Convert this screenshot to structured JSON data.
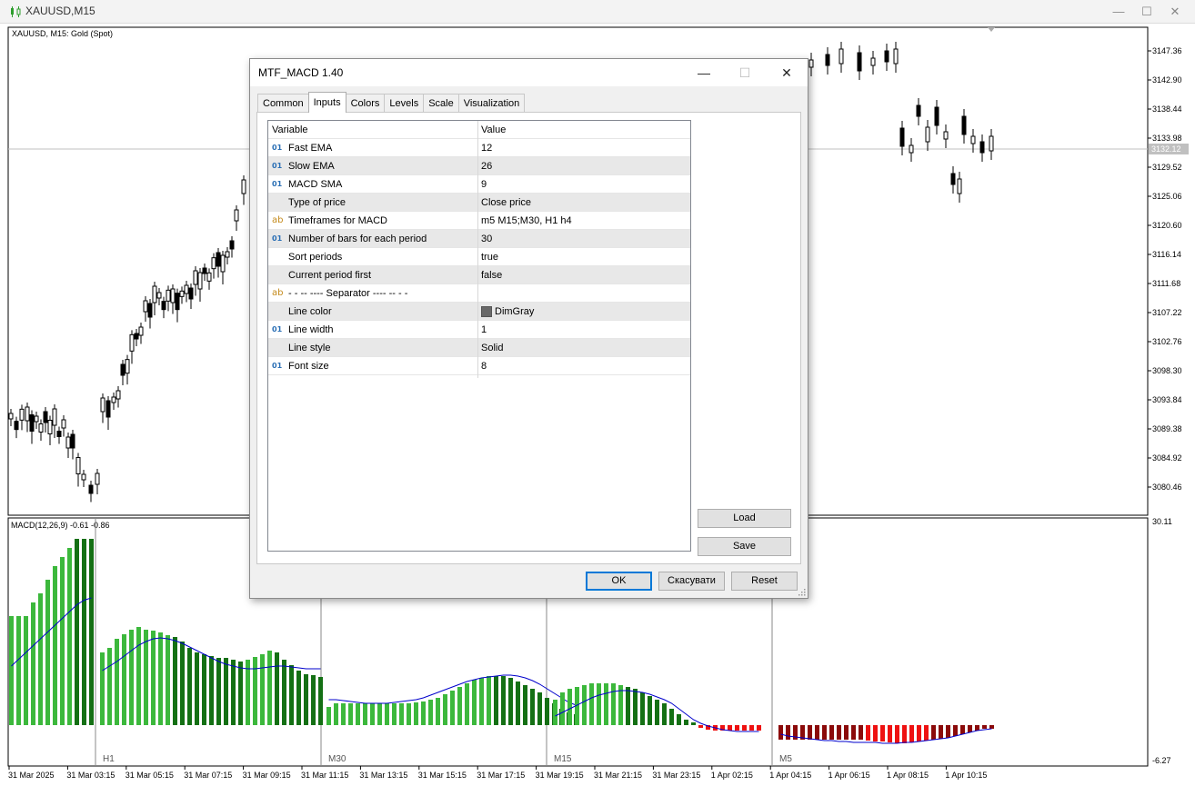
{
  "window": {
    "title": "XAUUSD,M15"
  },
  "chart": {
    "symbol_label": "XAUUSD, M15:  Gold (Spot)",
    "price_labels": [
      "3147.36",
      "3142.90",
      "3138.44",
      "3133.98",
      "3129.52",
      "3125.06",
      "3120.60",
      "3116.14",
      "3111.68",
      "3107.22",
      "3102.76",
      "3098.30",
      "3093.84",
      "3089.38",
      "3084.92",
      "3080.46"
    ],
    "current_price": "3132.12",
    "indicator_label": "MACD(12,26,9) -0.61 -0.86",
    "indicator_scale": [
      "30.11",
      "-6.27"
    ],
    "section_labels": [
      "H1",
      "M30",
      "M15",
      "M5"
    ],
    "time_labels": [
      "31 Mar 2025",
      "31 Mar 03:15",
      "31 Mar 05:15",
      "31 Mar 07:15",
      "31 Mar 09:15",
      "31 Mar 11:15",
      "31 Mar 13:15",
      "31 Mar 15:15",
      "31 Mar 17:15",
      "31 Mar 19:15",
      "31 Mar 21:15",
      "31 Mar 23:15",
      "1 Apr 02:15",
      "1 Apr 04:15",
      "1 Apr 06:15",
      "1 Apr 08:15",
      "1 Apr 10:15"
    ],
    "colors": {
      "bull_bar": "#3cb83c",
      "bear_bar": "#147014",
      "neg_bar": "#ee1111",
      "neg_dark_bar": "#8b0a0a",
      "signal_line": "#0000cc",
      "current_price_line": "#c0c0c0"
    }
  },
  "dialog": {
    "title": "MTF_MACD 1.40",
    "tabs": [
      {
        "label": "Common",
        "active": false
      },
      {
        "label": "Inputs",
        "active": true
      },
      {
        "label": "Colors",
        "active": false
      },
      {
        "label": "Levels",
        "active": false
      },
      {
        "label": "Scale",
        "active": false
      },
      {
        "label": "Visualization",
        "active": false
      }
    ],
    "grid_header": {
      "variable": "Variable",
      "value": "Value"
    },
    "rows": [
      {
        "icon": "int-icon",
        "icon_text": "01",
        "variable": "Fast EMA",
        "value": "12"
      },
      {
        "icon": "int-icon",
        "icon_text": "01",
        "variable": "Slow EMA",
        "value": "26"
      },
      {
        "icon": "int-icon",
        "icon_text": "01",
        "variable": "MACD SMA",
        "value": "9"
      },
      {
        "icon": "enum-icon",
        "icon_text": "",
        "variable": "Type of price",
        "value": "Close price"
      },
      {
        "icon": "string-icon",
        "icon_text": "ab",
        "variable": "Timeframes for MACD",
        "value": "m5 M15;M30, H1 h4"
      },
      {
        "icon": "int-icon",
        "icon_text": "01",
        "variable": "Number of bars for each period",
        "value": "30"
      },
      {
        "icon": "bool-icon",
        "icon_text": "",
        "variable": "Sort periods",
        "value": "true"
      },
      {
        "icon": "bool-icon",
        "icon_text": "",
        "variable": "Current period first",
        "value": "false"
      },
      {
        "icon": "string-icon",
        "icon_text": "ab",
        "variable": "-    -    -- ---- Separator ---- --    -    -",
        "value": ""
      },
      {
        "icon": "color-icon",
        "icon_text": "",
        "variable": "Line color",
        "value": "DimGray",
        "swatch": "#696969"
      },
      {
        "icon": "int-icon",
        "icon_text": "01",
        "variable": "Line width",
        "value": "1"
      },
      {
        "icon": "enum-icon",
        "icon_text": "",
        "variable": "Line style",
        "value": "Solid"
      },
      {
        "icon": "int-icon",
        "icon_text": "01",
        "variable": "Font size",
        "value": "8"
      }
    ],
    "load_label": "Load",
    "save_label": "Save",
    "ok_label": "OK",
    "cancel_label": "Скасувати",
    "reset_label": "Reset"
  }
}
